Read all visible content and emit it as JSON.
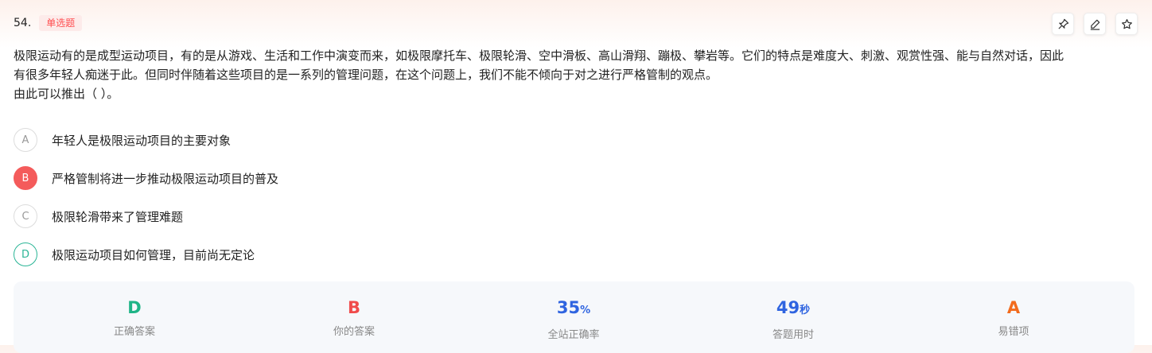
{
  "question": {
    "number": "54.",
    "type": "单选题",
    "stem_line1": "极限运动有的是成型运动项目，有的是从游戏、生活和工作中演变而来，如极限摩托车、极限轮滑、空中滑板、高山滑翔、蹦极、攀岩等。它们的特点是难度大、刺激、观赏性强、能与自然对话，因此",
    "stem_line2": "有很多年轻人痴迷于此。但同时伴随着这些项目的是一系列的管理问题，在这个问题上，我们不能不倾向于对之进行严格管制的观点。",
    "stem_line3": "由此可以推出（ ）。"
  },
  "toolbar": {
    "icons": [
      "pin-icon",
      "edit-icon",
      "star-icon"
    ]
  },
  "options": [
    {
      "letter": "A",
      "text": "年轻人是极限运动项目的主要对象",
      "state": "normal"
    },
    {
      "letter": "B",
      "text": "严格管制将进一步推动极限运动项目的普及",
      "state": "selected-wrong"
    },
    {
      "letter": "C",
      "text": "极限轮滑带来了管理难题",
      "state": "normal"
    },
    {
      "letter": "D",
      "text": "极限运动项目如何管理，目前尚无定论",
      "state": "correct"
    }
  ],
  "stats": {
    "correct_answer": {
      "value": "D",
      "label": "正确答案",
      "color": "#1fb487"
    },
    "your_answer": {
      "value": "B",
      "label": "你的答案",
      "color": "#f04b4b"
    },
    "accuracy": {
      "value": "35",
      "unit": "%",
      "label": "全站正确率",
      "color": "#2f64e0"
    },
    "time_used": {
      "value": "49",
      "unit": "秒",
      "label": "答题用时",
      "color": "#2f64e0"
    },
    "common_error": {
      "value": "A",
      "label": "易错项",
      "color": "#f26b1d"
    }
  }
}
